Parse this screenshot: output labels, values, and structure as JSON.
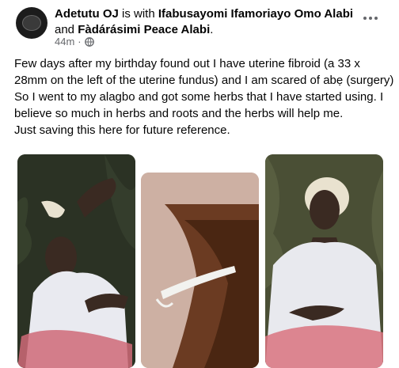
{
  "post": {
    "author": "Adetutu OJ",
    "connector": " is with ",
    "tagged1": "Ifabusayomi Ifamoriayo Omo Alabi",
    "and_text": "and ",
    "tagged2": "Fàdárásimi Peace Alabi",
    "period": ".",
    "time": "44m",
    "dot": "·",
    "privacy_icon": "globe-icon",
    "more_icon": "ellipsis-icon",
    "text_lines": [
      "Few days after my birthday found out I have uterine fibroid (a 33 x 28mm on the left of the uterine fundus) and I am scared of abẹ (surgery)",
      "So I went to my alagbo and got some herbs that I have started using. I believe so much in herbs and roots and the herbs will help me.",
      "Just saving this here for future reference."
    ]
  },
  "colors": {
    "text": "#050505",
    "meta": "#65676b"
  }
}
